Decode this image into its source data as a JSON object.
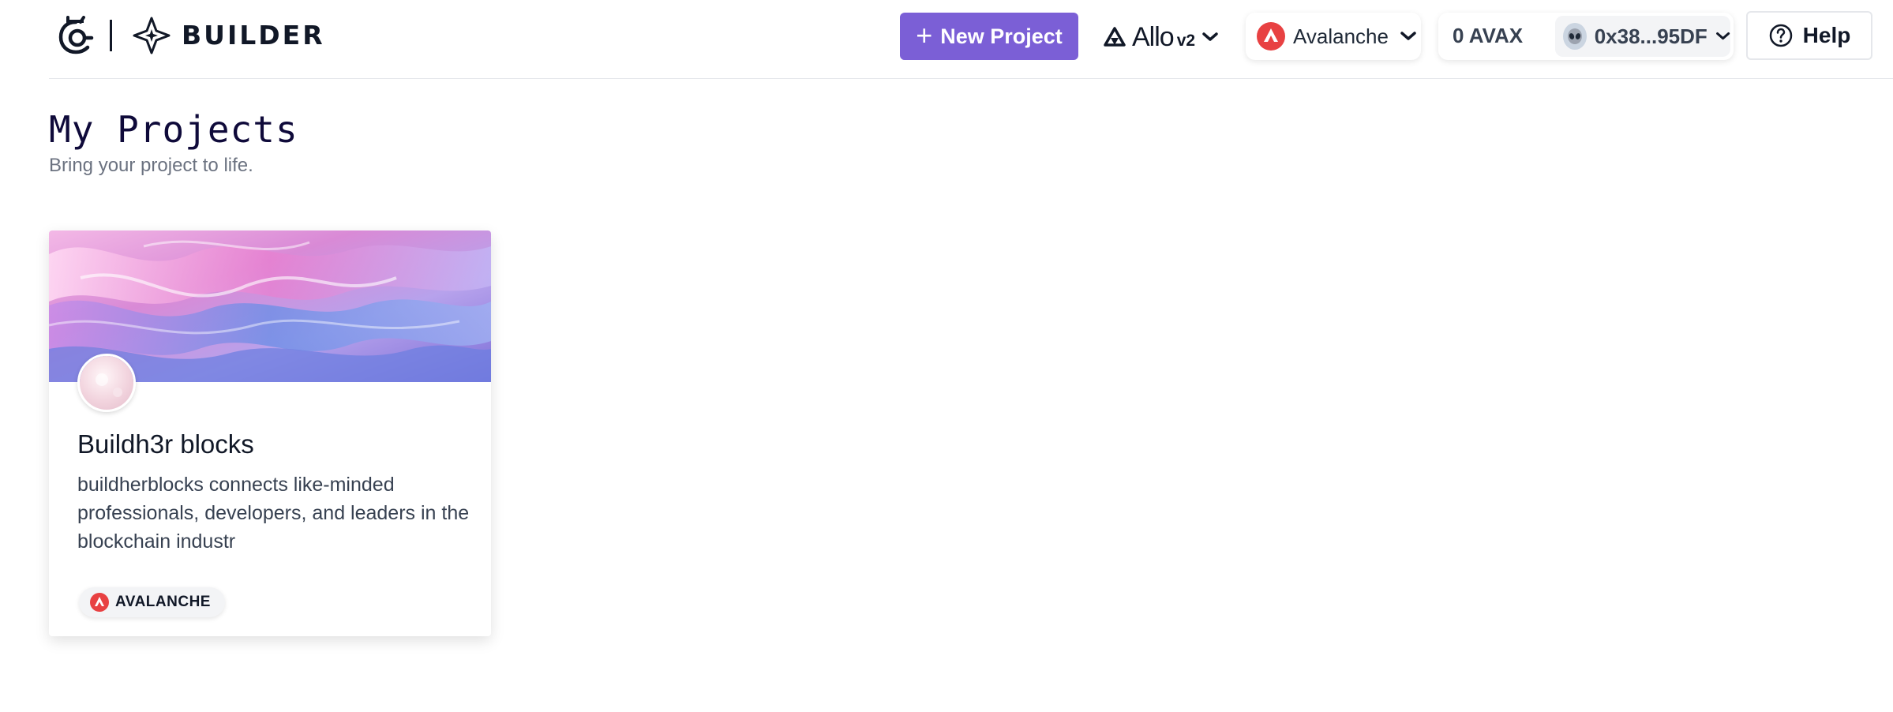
{
  "header": {
    "brand_text": "BUILDER",
    "new_project_label": "New Project",
    "protocol": {
      "name": "Allo",
      "version": "v2"
    },
    "chain": {
      "name": "Avalanche",
      "icon": "avalanche-icon",
      "color": "#e84142"
    },
    "wallet": {
      "balance": "0 AVAX",
      "address": "0x38...95DF",
      "avatar_icon": "alien-icon"
    },
    "help_label": "Help"
  },
  "page": {
    "title": "My Projects",
    "subtitle": "Bring your project to life."
  },
  "projects": [
    {
      "title": "Buildh3r blocks",
      "description": "buildherblocks connects like-minded professionals, developers, and leaders in the blockchain industr",
      "chain_badge": "AVALANCHE",
      "chain_icon": "avalanche-icon"
    }
  ],
  "colors": {
    "accent": "#7b5fd6",
    "avalanche_red": "#e84142",
    "title_color": "#0f0a3a"
  }
}
